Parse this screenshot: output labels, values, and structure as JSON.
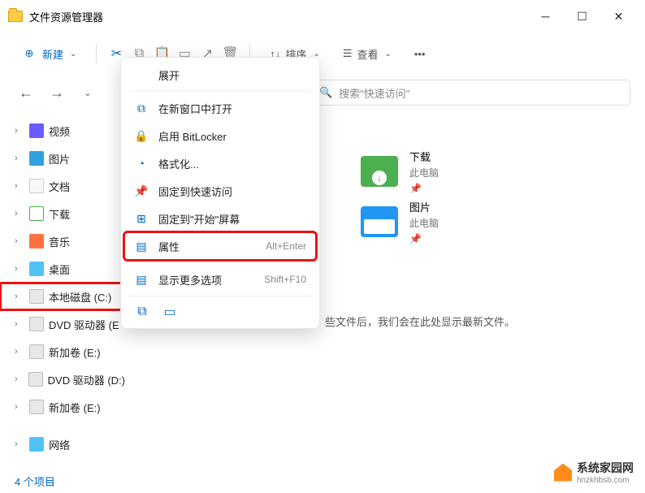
{
  "titlebar": {
    "title": "文件资源管理器"
  },
  "toolbar": {
    "new_label": "新建",
    "sort_label": "排序",
    "view_label": "查看"
  },
  "search": {
    "placeholder": "搜索\"快速访问\""
  },
  "sidebar": {
    "items": [
      {
        "label": "视频",
        "icon": "video"
      },
      {
        "label": "图片",
        "icon": "pic"
      },
      {
        "label": "文档",
        "icon": "doc"
      },
      {
        "label": "下载",
        "icon": "dl"
      },
      {
        "label": "音乐",
        "icon": "music"
      },
      {
        "label": "桌面",
        "icon": "desk"
      },
      {
        "label": "本地磁盘 (C:)",
        "icon": "disk",
        "highlight": true
      },
      {
        "label": "DVD 驱动器 (E",
        "icon": "dvd"
      },
      {
        "label": "新加卷 (E:)",
        "icon": "disk"
      },
      {
        "label": "DVD 驱动器 (D:)",
        "icon": "dvd"
      },
      {
        "label": "新加卷 (E:)",
        "icon": "disk"
      },
      {
        "label": "网络",
        "icon": "net"
      }
    ]
  },
  "context_menu": {
    "items": [
      {
        "label": "展开",
        "icon": ""
      },
      {
        "sep": true
      },
      {
        "label": "在新窗口中打开",
        "icon": "window"
      },
      {
        "label": "启用 BitLocker",
        "icon": "lock"
      },
      {
        "label": "格式化...",
        "icon": "format"
      },
      {
        "label": "固定到快速访问",
        "icon": "pin"
      },
      {
        "label": "固定到\"开始\"屏幕",
        "icon": "pin-start"
      },
      {
        "label": "属性",
        "icon": "props",
        "shortcut": "Alt+Enter",
        "highlight": true
      },
      {
        "sep": true
      },
      {
        "label": "显示更多选项",
        "icon": "more",
        "shortcut": "Shift+F10"
      },
      {
        "sep": true
      },
      {
        "iconrow": true
      }
    ]
  },
  "content": {
    "tiles": [
      {
        "name": "下载",
        "sub": "此电脑",
        "icon": "dl"
      },
      {
        "name": "图片",
        "sub": "此电脑",
        "icon": "pic"
      }
    ],
    "empty_hint": "些文件后，我们会在此处显示最新文件。"
  },
  "statusbar": {
    "text": "4 个项目"
  },
  "watermark": {
    "main": "系统家园网",
    "sub": "hnzkhbsb.com"
  }
}
